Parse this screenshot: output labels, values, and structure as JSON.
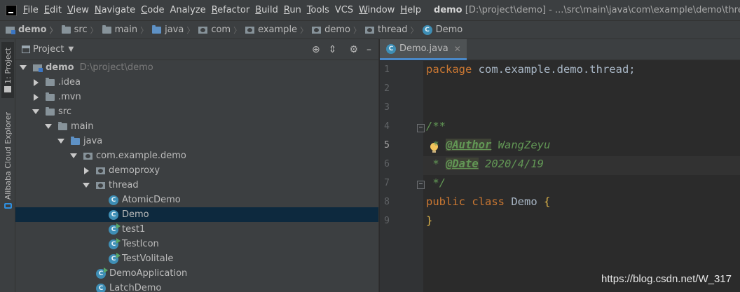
{
  "menubar": {
    "items": [
      {
        "mnemonic": "F",
        "rest": "ile"
      },
      {
        "mnemonic": "E",
        "rest": "dit"
      },
      {
        "mnemonic": "V",
        "rest": "iew"
      },
      {
        "mnemonic": "N",
        "rest": "avigate"
      },
      {
        "mnemonic": "C",
        "rest": "ode"
      },
      {
        "mnemonic": "",
        "rest": "Analyze"
      },
      {
        "mnemonic": "R",
        "rest": "efactor"
      },
      {
        "mnemonic": "B",
        "rest": "uild"
      },
      {
        "mnemonic": "R",
        "rest": "un"
      },
      {
        "mnemonic": "T",
        "rest": "ools"
      },
      {
        "mnemonic": "",
        "rest": "VCS"
      },
      {
        "mnemonic": "W",
        "rest": "indow"
      },
      {
        "mnemonic": "H",
        "rest": "elp"
      }
    ],
    "project_name": "demo",
    "window_title": "[D:\\project\\demo] - ...\\src\\main\\java\\com\\example\\demo\\thread\\Demo.java"
  },
  "breadcrumb": [
    "demo",
    "src",
    "main",
    "java",
    "com",
    "example",
    "demo",
    "thread",
    "Demo"
  ],
  "stripe": {
    "project_tab": "1: Project",
    "cloud_tab": "Alibaba Cloud Explorer"
  },
  "project_panel": {
    "title": "Project",
    "dropdown_icon": "chevron-down-icon",
    "tree": [
      {
        "label": "demo",
        "path": "D:\\project\\demo",
        "indent": 0,
        "arrow": "down",
        "icon": "module"
      },
      {
        "label": ".idea",
        "indent": 1,
        "arrow": "right",
        "icon": "folder"
      },
      {
        "label": ".mvn",
        "indent": 1,
        "arrow": "right",
        "icon": "folder"
      },
      {
        "label": "src",
        "indent": 1,
        "arrow": "down",
        "icon": "folder"
      },
      {
        "label": "main",
        "indent": 2,
        "arrow": "down",
        "icon": "folder"
      },
      {
        "label": "java",
        "indent": 3,
        "arrow": "down",
        "icon": "folder-blue"
      },
      {
        "label": "com.example.demo",
        "indent": 4,
        "arrow": "down",
        "icon": "package"
      },
      {
        "label": "demoproxy",
        "indent": 5,
        "arrow": "right",
        "icon": "package"
      },
      {
        "label": "thread",
        "indent": 5,
        "arrow": "down",
        "icon": "package"
      },
      {
        "label": "AtomicDemo",
        "indent": 6,
        "arrow": "none",
        "icon": "class"
      },
      {
        "label": "Demo",
        "indent": 6,
        "arrow": "none",
        "icon": "class",
        "selected": true
      },
      {
        "label": "test1",
        "indent": 6,
        "arrow": "none",
        "icon": "class-run"
      },
      {
        "label": "TestIcon",
        "indent": 6,
        "arrow": "none",
        "icon": "class-run"
      },
      {
        "label": "TestVolitale",
        "indent": 6,
        "arrow": "none",
        "icon": "class-run"
      },
      {
        "label": "DemoApplication",
        "indent": 5,
        "arrow": "none",
        "icon": "class-run"
      },
      {
        "label": "LatchDemo",
        "indent": 5,
        "arrow": "none",
        "icon": "class"
      }
    ]
  },
  "editor": {
    "tab_label": "Demo.java",
    "current_line": 5,
    "line_numbers": [
      "1",
      "2",
      "3",
      "4",
      "5",
      "6",
      "7",
      "8",
      "9"
    ],
    "code": {
      "l1_kw": "package",
      "l1_rest": " com.example.demo.thread;",
      "l3": "/**",
      "l4_star": " * ",
      "l4_tag": "@Author",
      "l4_val": " WangZeyu",
      "l5_star": " * ",
      "l5_tag": "@Date",
      "l5_val": " 2020/4/19",
      "l6": " */",
      "l7_kw1": "public",
      "l7_kw2": " class",
      "l7_name": " Demo",
      "l7_brace": " {",
      "l8_brace": "}"
    }
  },
  "watermark": "https://blog.csdn.net/W_317",
  "colors": {
    "selection": "#0d293e",
    "keyword": "#cc7832",
    "doc_comment": "#629755",
    "class_icon": "#3e8eb5"
  }
}
